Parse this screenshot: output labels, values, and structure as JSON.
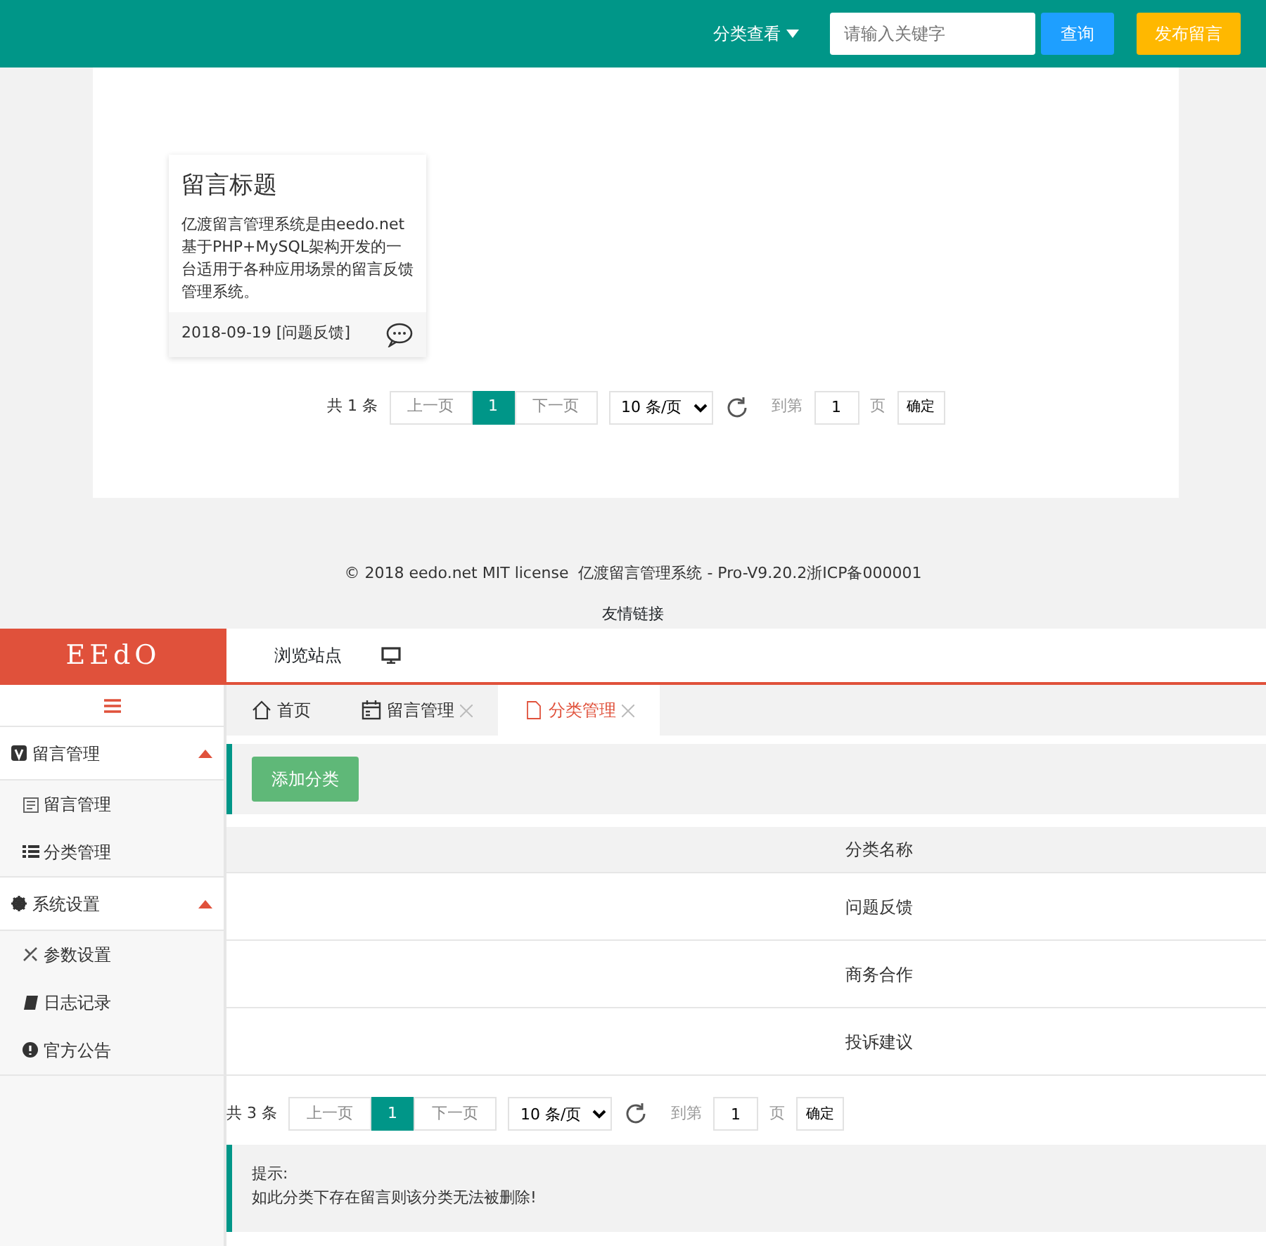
{
  "front": {
    "header": {
      "category_menu": "分类查看",
      "search": {
        "placeholder": "请输入关键字"
      },
      "search_button": "查询",
      "post_button": "发布留言"
    },
    "posts": [
      {
        "title": "留言标题",
        "body": "亿渡留言管理系统是由eedo.net基于PHP+MySQL架构开发的一台适用于各种应用场景的留言反馈管理系统。",
        "date": "2018-09-19",
        "category": "[问题反馈]"
      }
    ],
    "pagination": {
      "total": "共 1 条",
      "prev": "上一页",
      "pages": [
        {
          "label": "1",
          "selected": true
        }
      ],
      "next": "下一页",
      "page_size": "10 条/页",
      "goto_label": "到第",
      "goto_value": "1",
      "page_unit": "页",
      "confirm": "确定"
    },
    "footer": {
      "copyright": "© 2018 eedo.net MIT license  亿渡留言管理系统 - Pro-V9.20.2浙ICP备000001",
      "links": "友情链接"
    }
  },
  "admin": {
    "logo": "EEdO",
    "top_nav": [
      "浏览站点"
    ],
    "sidebar": [
      {
        "label": "留言管理",
        "expanded": true,
        "children": [
          {
            "label": "留言管理"
          },
          {
            "label": "分类管理"
          }
        ]
      },
      {
        "label": "系统设置",
        "expanded": true,
        "children": [
          {
            "label": "参数设置"
          },
          {
            "label": "日志记录"
          },
          {
            "label": "官方公告"
          }
        ]
      }
    ],
    "tabs": [
      {
        "label": "首页",
        "closable": false,
        "selected": false
      },
      {
        "label": "留言管理",
        "closable": true,
        "selected": false
      },
      {
        "label": "分类管理",
        "closable": true,
        "selected": true
      }
    ],
    "add_button": "添加分类",
    "table": {
      "columns": [
        "分类名称"
      ],
      "rows": [
        [
          "问题反馈"
        ],
        [
          "商务合作"
        ],
        [
          "投诉建议"
        ]
      ]
    },
    "pagination": {
      "total": "共 3 条",
      "prev": "上一页",
      "pages": [
        {
          "label": "1",
          "selected": true
        }
      ],
      "next": "下一页",
      "page_size": "10 条/页",
      "goto_label": "到第",
      "goto_value": "1",
      "page_unit": "页",
      "confirm": "确定"
    },
    "tip": {
      "title": "提示:",
      "text": "如此分类下存在留言则该分类无法被删除!"
    }
  }
}
